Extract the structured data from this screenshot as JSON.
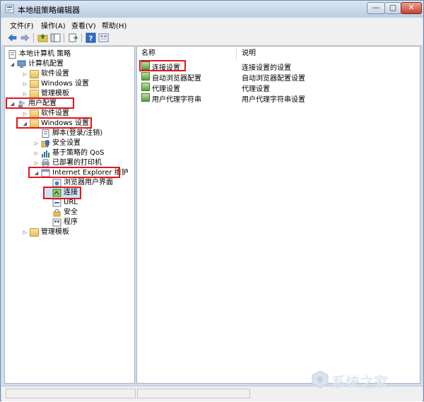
{
  "window": {
    "title": "本地组策略编辑器",
    "min_glyph": "—",
    "max_glyph": "▢",
    "close_glyph": "✕"
  },
  "menu": [
    "文件(F)",
    "操作(A)",
    "查看(V)",
    "帮助(H)"
  ],
  "toolbar": {
    "buttons": [
      "back-arrow-icon",
      "forward-arrow-icon",
      "up-folder-icon",
      "show-hide-tree-icon",
      "export-list-icon",
      "help-icon",
      "properties-icon"
    ]
  },
  "tree": {
    "root": "本地计算机 策略",
    "computer_config": "计算机配置",
    "cc_software": "软件设置",
    "cc_windows": "Windows 设置",
    "cc_admin": "管理模板",
    "user_config": "用户配置",
    "uc_software": "软件设置",
    "uc_windows": "Windows 设置",
    "scripts": "脚本(登录/注销)",
    "security": "安全设置",
    "qos": "基于策略的 QoS",
    "printers": "已部署的打印机",
    "ie": "Internet Explorer 维护",
    "ie_ui": "浏览器用户界面",
    "ie_conn": "连接",
    "ie_url": "URL",
    "ie_sec": "安全",
    "ie_prog": "程序",
    "uc_admin": "管理模板"
  },
  "list": {
    "col_name": "名称",
    "col_desc": "说明",
    "rows": [
      {
        "name": "连接设置",
        "desc": "连接设置的设置"
      },
      {
        "name": "自动浏览器配置",
        "desc": "自动浏览器配置设置"
      },
      {
        "name": "代理设置",
        "desc": "代理设置"
      },
      {
        "name": "用户代理字符串",
        "desc": "用户代理字符串设置"
      }
    ]
  },
  "watermark": {
    "text": "系统之家",
    "sub": "XITONGZHIJIA.NET"
  },
  "colors": {
    "highlight": "#e8141b",
    "title_bg": "#cfdcec",
    "folder": "#e7bf59"
  }
}
